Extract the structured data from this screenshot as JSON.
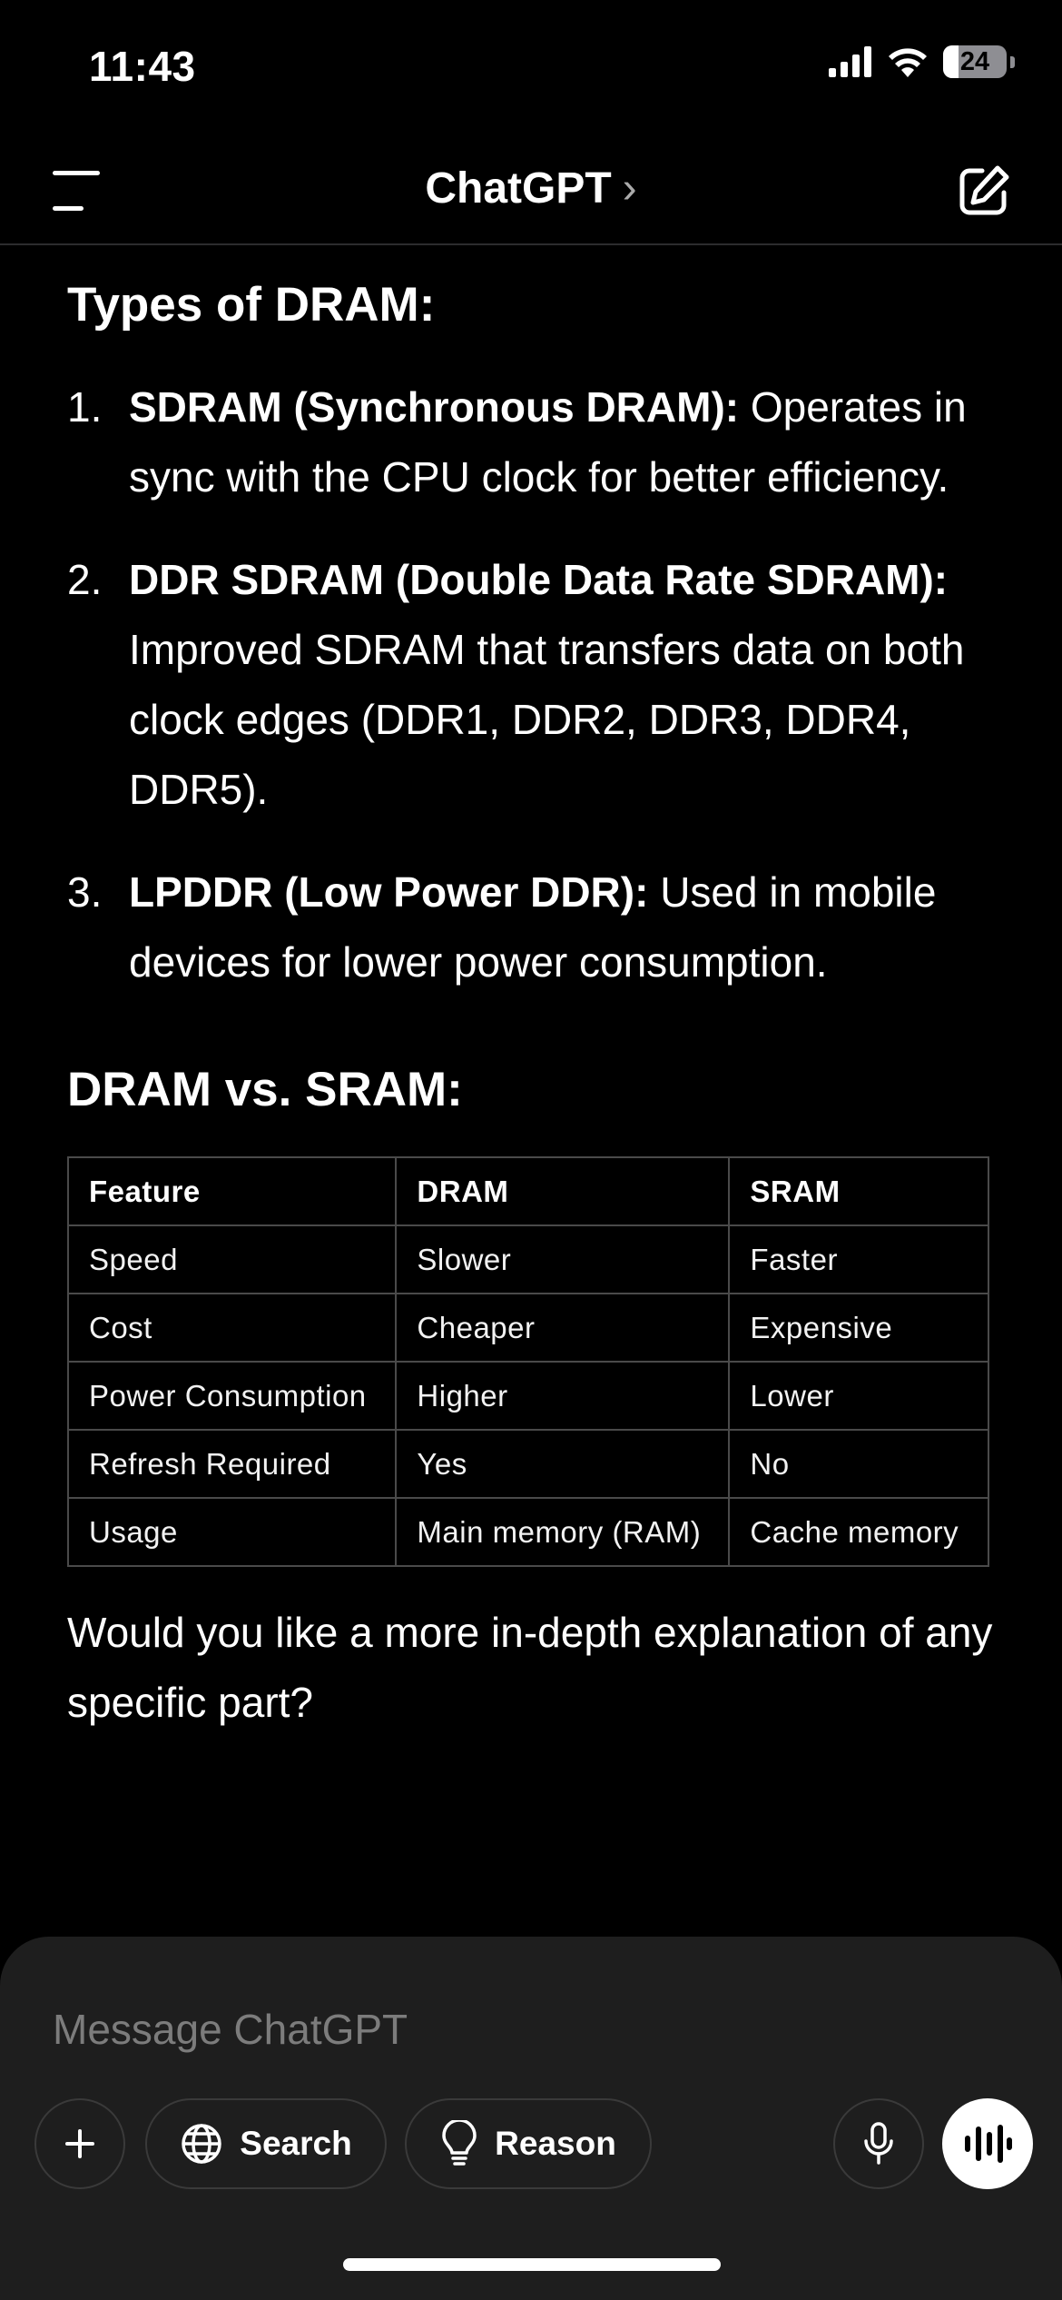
{
  "status_bar": {
    "time": "11:43",
    "battery_level": "24",
    "battery_fraction": 0.24
  },
  "header": {
    "title": "ChatGPT",
    "title_chevron": "›",
    "menu_icon": "menu-icon",
    "new_chat_icon": "compose-icon"
  },
  "content": {
    "types_heading": "Types of DRAM:",
    "types": [
      {
        "number": "1.",
        "bold": "SDRAM (Synchronous DRAM):",
        "text": " Operates in sync with the CPU clock for better efficiency."
      },
      {
        "number": "2.",
        "bold": "DDR SDRAM (Double Data Rate SDRAM):",
        "text": " Improved SDRAM that transfers data on both clock edges (DDR1, DDR2, DDR3, DDR4, DDR5)."
      },
      {
        "number": "3.",
        "bold": "LPDDR (Low Power DDR):",
        "text": " Used in mobile devices for lower power consumption."
      }
    ],
    "vs_heading": "DRAM vs. SRAM:",
    "table": {
      "headers": [
        "Feature",
        "DRAM",
        "SRAM"
      ],
      "rows": [
        [
          "Speed",
          "Slower",
          "Faster"
        ],
        [
          "Cost",
          "Cheaper",
          "Expensive"
        ],
        [
          "Power Consumption",
          "Higher",
          "Lower"
        ],
        [
          "Refresh Required",
          "Yes",
          "No"
        ],
        [
          "Usage",
          "Main memory (RAM)",
          "Cache memory"
        ]
      ]
    },
    "closing": "Would you like a more in-depth explanation of any specific part?"
  },
  "composer": {
    "placeholder": "Message ChatGPT",
    "search_label": "Search",
    "reason_label": "Reason",
    "plus_icon": "plus-icon",
    "search_icon": "globe-icon",
    "reason_icon": "lightbulb-icon",
    "mic_icon": "microphone-icon",
    "voice_icon": "voice-wave-icon"
  },
  "colors": {
    "background": "#000000",
    "composer_bg": "#1e1e1e",
    "table_border": "#4a4a4a",
    "placeholder": "#7c7c7c"
  }
}
